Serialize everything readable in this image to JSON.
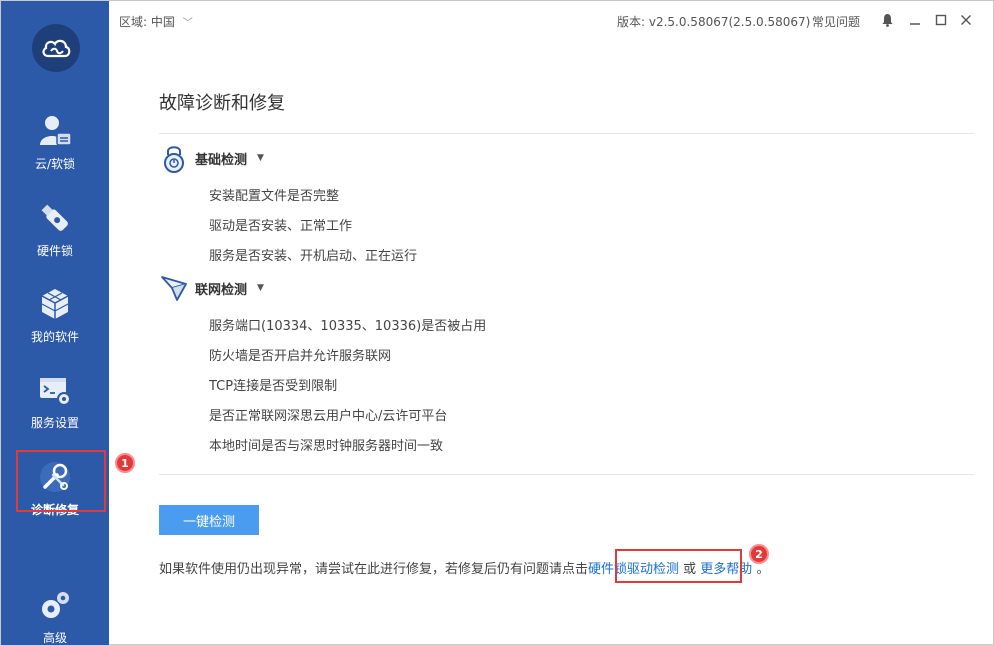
{
  "topbar": {
    "region_label": "区域:",
    "region_value": "中国",
    "version": "版本: v2.5.0.58067(2.5.0.58067)",
    "faq": "常见问题"
  },
  "sidebar": {
    "items": [
      {
        "label": "云/软锁",
        "icon": "user-lock-icon"
      },
      {
        "label": "硬件锁",
        "icon": "usb-dongle-icon"
      },
      {
        "label": "我的软件",
        "icon": "cubes-icon"
      },
      {
        "label": "服务设置",
        "icon": "terminal-gear-icon"
      },
      {
        "label": "诊断修复",
        "icon": "wrench-screwdriver-icon"
      },
      {
        "label": "高级",
        "icon": "gears-icon"
      }
    ]
  },
  "main": {
    "title": "故障诊断和修复",
    "basic": {
      "label": "基础检测",
      "items": [
        "安装配置文件是否完整",
        "驱动是否安装、正常工作",
        "服务是否安装、开机启动、正在运行"
      ]
    },
    "network": {
      "label": "联网检测",
      "items": [
        "服务端口(10334、10335、10336)是否被占用",
        "防火墙是否开启并允许服务联网",
        "TCP连接是否受到限制",
        "是否正常联网深思云用户中心/云许可平台",
        "本地时间是否与深思时钟服务器时间一致"
      ]
    },
    "check_button": "一键检测",
    "footnote_prefix": "如果软件使用仍出现异常，请尝试在此进行修复，若修复后仍有问题请点击",
    "link_hw": "硬件锁驱动检测",
    "footnote_or": " 或 ",
    "link_more": "更多帮助",
    "footnote_end": " 。"
  },
  "markers": {
    "one": "1",
    "two": "2"
  },
  "colors": {
    "sidebar": "#2c59a8",
    "accent": "#4a9cf0",
    "link": "#1a6fd0",
    "marker": "#e03a3a"
  }
}
